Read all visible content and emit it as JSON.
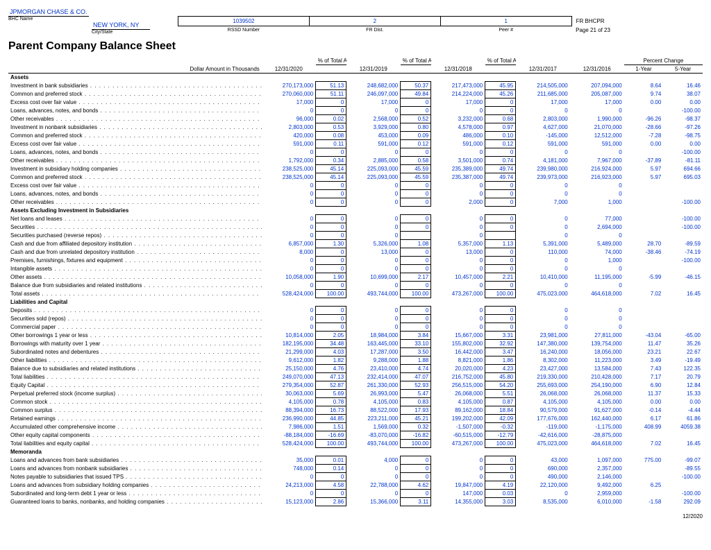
{
  "header": {
    "company": "JPMORGAN CHASE & CO.",
    "city": "NEW YORK, NY",
    "bhc_label": "BHC Name",
    "city_label": "City/State",
    "rssd": "1039502",
    "fr": "2",
    "peer": "1",
    "form": "FR BHCPR",
    "page": "Page 21 of 23",
    "rssd_l": "RSSD Number",
    "fr_l": "FR Dist.",
    "peer_l": "Peer #",
    "title": "Parent Company Balance Sheet",
    "unit": "Dollar Amount in Thousands"
  },
  "cols": [
    "12/31/2020",
    "12/31/2019",
    "12/31/2018",
    "12/31/2017",
    "12/31/2016"
  ],
  "pct": "% of Total Assets",
  "pchg": "Percent Change",
  "y1": "1-Year",
  "y5": "5-Year",
  "sections": [
    {
      "h": "Assets",
      "rows": [
        [
          "Investment in bank subsidiaries",
          "270,173,000",
          "51.13",
          "248,682,000",
          "50.37",
          "217,473,000",
          "45.95",
          "214,505,000",
          "207,094,000",
          "8.64",
          "16.46"
        ],
        [
          "  Common and preferred stock",
          "270,060,000",
          "51.11",
          "246,097,000",
          "49.84",
          "214,224,000",
          "45.26",
          "211,685,000",
          "205,087,000",
          "9.74",
          "38.07"
        ],
        [
          "  Excess cost over fair value",
          "17,000",
          "0",
          "17,000",
          "0",
          "17,000",
          "0",
          "17,000",
          "17,000",
          "0.00",
          "0.00"
        ],
        [
          "  Loans, advances, notes, and bonds",
          "0",
          "0",
          "0",
          "0",
          "0",
          "0",
          "0",
          "0",
          "",
          "-100.00"
        ],
        [
          "  Other receivables",
          "96,000",
          "0.02",
          "2,568,000",
          "0.52",
          "3,232,000",
          "0.68",
          "2,803,000",
          "1,990,000",
          "-96.26",
          "-98.37"
        ],
        [
          "Investment in nonbank subsidiaries",
          "2,803,000",
          "0.53",
          "3,929,000",
          "0.80",
          "4,578,000",
          "0.97",
          "4,627,000",
          "21,070,000",
          "-28.66",
          "-97.26"
        ],
        [
          "  Common and preferred stock",
          "420,000",
          "0.08",
          "453,000",
          "0.09",
          "486,000",
          "0.10",
          "-145,000",
          "12,512,000",
          "-7.28",
          "-98.75"
        ],
        [
          "  Excess cost over fair value",
          "591,000",
          "0.11",
          "591,000",
          "0.12",
          "591,000",
          "0.12",
          "591,000",
          "591,000",
          "0.00",
          "0.00"
        ],
        [
          "  Loans, advances, notes, and bonds",
          "0",
          "0",
          "0",
          "0",
          "0",
          "0",
          "0",
          "0",
          "",
          "-100.00"
        ],
        [
          "  Other receivables",
          "1,792,000",
          "0.34",
          "2,885,000",
          "0.58",
          "3,501,000",
          "0.74",
          "4,181,000",
          "7,967,000",
          "-37.89",
          "-81.11"
        ],
        [
          "Investment in subsidiary holding companies",
          "238,525,000",
          "45.14",
          "225,093,000",
          "45.59",
          "235,389,000",
          "49.74",
          "239,980,000",
          "216,924,000",
          "5.97",
          "694.66"
        ],
        [
          "  Common and preferred stock",
          "238,525,000",
          "45.14",
          "225,093,000",
          "45.59",
          "235,387,000",
          "49.74",
          "239,973,000",
          "216,923,000",
          "5.97",
          "695.03"
        ],
        [
          "  Excess cost over fair value",
          "0",
          "0",
          "0",
          "0",
          "0",
          "0",
          "0",
          "0",
          "",
          ""
        ],
        [
          "  Loans, advances, notes, and bonds",
          "0",
          "0",
          "0",
          "0",
          "0",
          "0",
          "0",
          "0",
          "",
          ""
        ],
        [
          "  Other receivables",
          "0",
          "0",
          "0",
          "0",
          "2,000",
          "0",
          "7,000",
          "1,000",
          "",
          "-100.00"
        ]
      ]
    },
    {
      "h": "Assets Excluding Investment in Subsidiaries",
      "rows": [
        [
          "Net loans and leases",
          "0",
          "0",
          "0",
          "0",
          "0",
          "0",
          "0",
          "77,000",
          "",
          "-100.00"
        ],
        [
          "Securities",
          "0",
          "0",
          "0",
          "0",
          "0",
          "0",
          "0",
          "2,694,000",
          "",
          "-100.00"
        ],
        [
          "Securities purchased (reverse repos)",
          "0",
          "0",
          "0",
          "",
          "0",
          "",
          "0",
          "0",
          "",
          ""
        ],
        [
          "Cash and due from affiliated depository institution",
          "6,857,000",
          "1.30",
          "5,326,000",
          "1.08",
          "5,357,000",
          "1.13",
          "5,391,000",
          "5,489,000",
          "28.70",
          "-89.59"
        ],
        [
          "Cash and due from unrelated depository institution",
          "8,000",
          "0",
          "13,000",
          "0",
          "13,000",
          "0",
          "110,000",
          "74,000",
          "-38.46",
          "-74.19"
        ],
        [
          "Premises, furnishings, fixtures and equipment",
          "0",
          "0",
          "0",
          "0",
          "0",
          "0",
          "0",
          "1,000",
          "",
          "-100.00"
        ],
        [
          "Intangible assets",
          "0",
          "0",
          "0",
          "0",
          "0",
          "0",
          "0",
          "0",
          "",
          ""
        ],
        [
          "Other assets",
          "10,058,000",
          "1.90",
          "10,699,000",
          "2.17",
          "10,457,000",
          "2.21",
          "10,410,000",
          "11,195,000",
          "-5.99",
          "-46.15"
        ],
        [
          "Balance due from subsidiaries and related institutions",
          "0",
          "0",
          "0",
          "0",
          "0",
          "0",
          "0",
          "0",
          "",
          ""
        ],
        [
          "   Total assets",
          "528,424,000",
          "100.00",
          "493,744,000",
          "100.00",
          "473,267,000",
          "100.00",
          "475,023,000",
          "464,618,000",
          "7.02",
          "16.45"
        ]
      ]
    },
    {
      "h": "Liabilities and Capital",
      "rows": [
        [
          "Deposits",
          "0",
          "0",
          "0",
          "0",
          "0",
          "0",
          "0",
          "0",
          "",
          ""
        ],
        [
          "Securities sold (repos)",
          "0",
          "0",
          "0",
          "0",
          "0",
          "0",
          "0",
          "0",
          "",
          ""
        ],
        [
          "Commercial paper",
          "0",
          "0",
          "0",
          "0",
          "0",
          "0",
          "0",
          "0",
          "",
          ""
        ],
        [
          "Other borrowings 1 year or less",
          "10,814,000",
          "2.05",
          "18,984,000",
          "3.84",
          "15,667,000",
          "3.31",
          "23,981,000",
          "27,811,000",
          "-43.04",
          "-65.00"
        ],
        [
          "Borrowings with maturity over 1 year",
          "182,195,000",
          "34.48",
          "163,445,000",
          "33.10",
          "155,802,000",
          "32.92",
          "147,380,000",
          "139,754,000",
          "11.47",
          "35.26"
        ],
        [
          "Subordinated notes and debentures",
          "21,299,000",
          "4.03",
          "17,287,000",
          "3.50",
          "16,442,000",
          "3.47",
          "16,240,000",
          "18,056,000",
          "23.21",
          "22.67"
        ],
        [
          "Other liabilities",
          "9,612,000",
          "1.82",
          "9,288,000",
          "1.88",
          "8,821,000",
          "1.86",
          "8,302,000",
          "11,223,000",
          "3.49",
          "-19.49"
        ],
        [
          "Balance due to subsidiaries and related institutions",
          "25,150,000",
          "4.76",
          "23,410,000",
          "4.74",
          "20,020,000",
          "4.23",
          "23,427,000",
          "13,584,000",
          "7.43",
          "122.35"
        ],
        [
          "   Total liabilities",
          "249,070,000",
          "47.13",
          "232,414,000",
          "47.07",
          "216,752,000",
          "45.80",
          "219,330,000",
          "210,428,000",
          "7.17",
          "20.79"
        ],
        [
          "Equity Capital",
          "279,354,000",
          "52.87",
          "261,330,000",
          "52.93",
          "256,515,000",
          "54.20",
          "255,693,000",
          "254,190,000",
          "6.90",
          "12.84"
        ],
        [
          "   Perpetual preferred stock (income surplus)",
          "30,063,000",
          "5.69",
          "26,993,000",
          "5.47",
          "26,068,000",
          "5.51",
          "26,068,000",
          "26,068,000",
          "11.37",
          "15.33"
        ],
        [
          "   Common stock",
          "4,105,000",
          "0.78",
          "4,105,000",
          "0.83",
          "4,105,000",
          "0.87",
          "4,105,000",
          "4,105,000",
          "0.00",
          "0.00"
        ],
        [
          "   Common surplus",
          "88,394,000",
          "16.73",
          "88,522,000",
          "17.93",
          "89,162,000",
          "18.84",
          "90,579,000",
          "91,627,000",
          "-0.14",
          "-4.44"
        ],
        [
          "   Retained earnings",
          "236,990,000",
          "44.85",
          "223,211,000",
          "45.21",
          "199,202,000",
          "42.09",
          "177,676,000",
          "162,440,000",
          "6.17",
          "61.86"
        ],
        [
          "   Accumulated other comprehensive income",
          "7,986,000",
          "1.51",
          "1,569,000",
          "0.32",
          "-1,507,000",
          "-0.32",
          "-119,000",
          "-1,175,000",
          "408.99",
          "4059.38"
        ],
        [
          "   Other equity capital components",
          "-88,184,000",
          "-16.69",
          "-83,070,000",
          "-16.82",
          "-60,515,000",
          "-12.79",
          "-42,616,000",
          "-28,875,000",
          "",
          ""
        ],
        [
          "Total liabilities and equity capital",
          "528,424,000",
          "100.00",
          "493,744,000",
          "100.00",
          "473,267,000",
          "100.00",
          "475,023,000",
          "464,618,000",
          "7.02",
          "16.45"
        ]
      ]
    },
    {
      "h": "Memoranda",
      "rows": [
        [
          "Loans and advances from bank subsidiaries",
          "35,000",
          "0.01",
          "4,000",
          "0",
          "0",
          "0",
          "43,000",
          "1,097,000",
          "775.00",
          "-99.07"
        ],
        [
          "Loans and advances from nonbank subsidiaries",
          "748,000",
          "0.14",
          "0",
          "0",
          "0",
          "0",
          "690,000",
          "2,357,000",
          "",
          "-89.55"
        ],
        [
          "   Notes payable to subsidiaries that issued TPS",
          "0",
          "0",
          "0",
          "0",
          "0",
          "0",
          "490,000",
          "2,146,000",
          "",
          "-100.00"
        ],
        [
          "Loans and advances from subsidiary holding companies",
          "24,213,000",
          "4.58",
          "22,788,000",
          "4.62",
          "19,847,000",
          "4.19",
          "22,120,000",
          "9,492,000",
          "6.25",
          ""
        ],
        [
          "Subordinated and long-term debt 1 year or less",
          "0",
          "0",
          "0",
          "0",
          "147,000",
          "0.03",
          "0",
          "2,959,000",
          "",
          "-100.00"
        ],
        [
          "Guaranteed loans to banks, nonbanks, and holding companies",
          "15,123,000",
          "2.86",
          "15,366,000",
          "3.11",
          "14,355,000",
          "3.03",
          "8,535,000",
          "6,010,000",
          "-1.58",
          "292.09"
        ]
      ]
    }
  ],
  "footer": "12/2020"
}
